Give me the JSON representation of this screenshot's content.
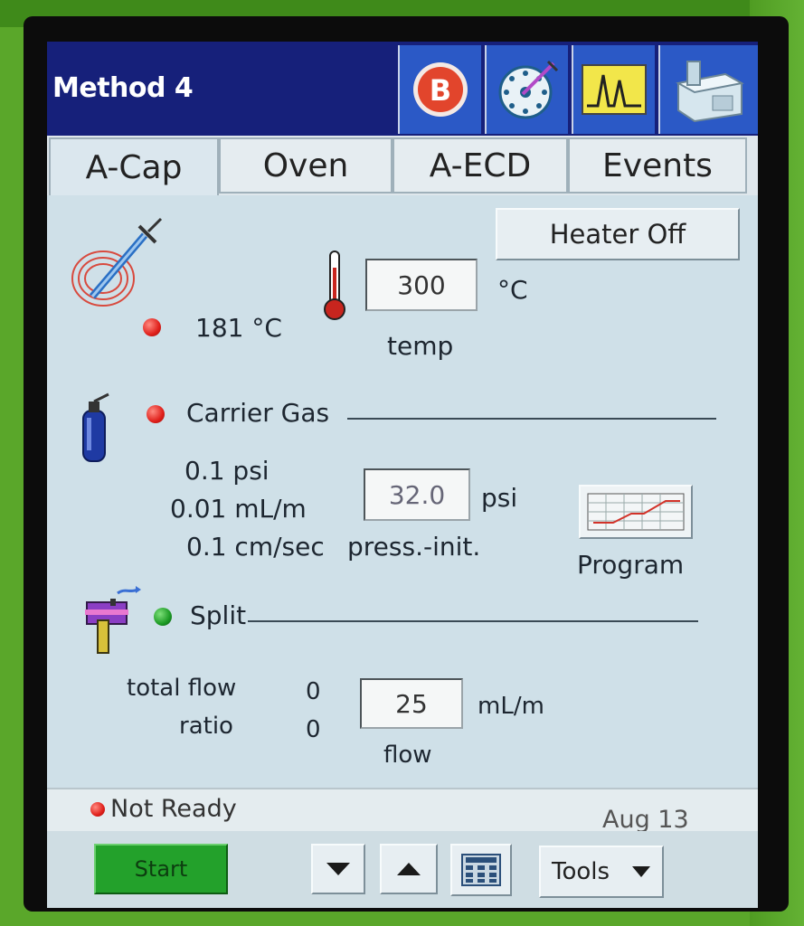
{
  "title": "Method 4",
  "tabs": [
    "A-Cap",
    "Oven",
    "A-ECD",
    "Events"
  ],
  "inlet": {
    "heater_button": "Heater Off",
    "temp_setpoint": "300",
    "temp_unit": "°C",
    "temp_label": "temp",
    "actual_temp": "181 °C"
  },
  "carrier": {
    "section_label": "Carrier Gas",
    "pressure_actual": "0.1 psi",
    "flow_actual": "0.01 mL/m",
    "velocity_actual": "0.1 cm/sec",
    "pressure_setpoint": "32.0",
    "pressure_unit": "psi",
    "pressure_label": "press.-init.",
    "program_label": "Program"
  },
  "split": {
    "section_label": "Split",
    "total_flow_label": "total flow",
    "total_flow_value": "0",
    "ratio_label": "ratio",
    "ratio_value": "0",
    "flow_setpoint": "25",
    "flow_unit": "mL/m",
    "flow_label": "flow"
  },
  "status": {
    "text": "Not Ready",
    "date": "Aug 13"
  },
  "toolbar": {
    "start_label": "Start",
    "tools_label": "Tools"
  },
  "colors": {
    "title_bar": "#16207a",
    "accent_blue": "#2b59c6",
    "status_red": "#e0201b",
    "status_green": "#1c9a24",
    "start_green": "#23a12b"
  },
  "icons": [
    "b-icon",
    "sampler-dial-icon",
    "chromatogram-icon",
    "instrument-icon",
    "syringe-coil-icon",
    "thermometer-icon",
    "gas-cylinder-icon",
    "split-valve-icon",
    "program-graph-icon",
    "down-arrow-icon",
    "up-arrow-icon",
    "keypad-icon",
    "dropdown-arrow-icon"
  ]
}
